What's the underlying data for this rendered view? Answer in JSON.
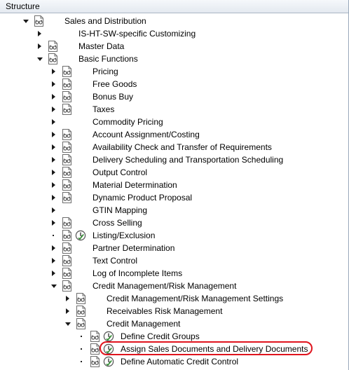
{
  "header": {
    "title": "Structure"
  },
  "tree": [
    {
      "label": "Sales and Distribution",
      "level": 0,
      "node": "down",
      "doc": true,
      "clock": false
    },
    {
      "label": "IS-HT-SW-specific Customizing",
      "level": 1,
      "node": "right",
      "doc": false,
      "clock": false
    },
    {
      "label": "Master Data",
      "level": 1,
      "node": "right",
      "doc": true,
      "clock": false
    },
    {
      "label": "Basic Functions",
      "level": 1,
      "node": "down",
      "doc": true,
      "clock": false
    },
    {
      "label": "Pricing",
      "level": 2,
      "node": "right",
      "doc": true,
      "clock": false
    },
    {
      "label": "Free Goods",
      "level": 2,
      "node": "right",
      "doc": true,
      "clock": false
    },
    {
      "label": "Bonus Buy",
      "level": 2,
      "node": "right",
      "doc": true,
      "clock": false
    },
    {
      "label": "Taxes",
      "level": 2,
      "node": "right",
      "doc": true,
      "clock": false
    },
    {
      "label": "Commodity Pricing",
      "level": 2,
      "node": "right",
      "doc": false,
      "clock": false
    },
    {
      "label": "Account Assignment/Costing",
      "level": 2,
      "node": "right",
      "doc": true,
      "clock": false
    },
    {
      "label": "Availability Check and Transfer of Requirements",
      "level": 2,
      "node": "right",
      "doc": true,
      "clock": false
    },
    {
      "label": "Delivery Scheduling and Transportation Scheduling",
      "level": 2,
      "node": "right",
      "doc": true,
      "clock": false
    },
    {
      "label": "Output Control",
      "level": 2,
      "node": "right",
      "doc": true,
      "clock": false
    },
    {
      "label": "Material Determination",
      "level": 2,
      "node": "right",
      "doc": true,
      "clock": false
    },
    {
      "label": "Dynamic Product Proposal",
      "level": 2,
      "node": "right",
      "doc": true,
      "clock": false
    },
    {
      "label": "GTIN Mapping",
      "level": 2,
      "node": "right",
      "doc": false,
      "clock": false
    },
    {
      "label": "Cross Selling",
      "level": 2,
      "node": "right",
      "doc": true,
      "clock": false
    },
    {
      "label": "Listing/Exclusion",
      "level": 2,
      "node": "dot",
      "doc": true,
      "clock": true
    },
    {
      "label": "Partner Determination",
      "level": 2,
      "node": "right",
      "doc": true,
      "clock": false
    },
    {
      "label": "Text Control",
      "level": 2,
      "node": "right",
      "doc": true,
      "clock": false
    },
    {
      "label": "Log of Incomplete Items",
      "level": 2,
      "node": "right",
      "doc": true,
      "clock": false
    },
    {
      "label": "Credit Management/Risk Management",
      "level": 2,
      "node": "down",
      "doc": true,
      "clock": false
    },
    {
      "label": "Credit Management/Risk Management Settings",
      "level": 3,
      "node": "right",
      "doc": true,
      "clock": false
    },
    {
      "label": "Receivables Risk Management",
      "level": 3,
      "node": "right",
      "doc": true,
      "clock": false
    },
    {
      "label": "Credit Management",
      "level": 3,
      "node": "down",
      "doc": true,
      "clock": false
    },
    {
      "label": "Define Credit Groups",
      "level": 4,
      "node": "dot",
      "doc": true,
      "clock": true
    },
    {
      "label": "Assign Sales Documents and Delivery Documents",
      "level": 4,
      "node": "dot",
      "doc": true,
      "clock": true,
      "highlighted": true
    },
    {
      "label": "Define Automatic Credit Control",
      "level": 4,
      "node": "dot",
      "doc": true,
      "clock": true
    }
  ],
  "colors": {
    "highlight": "#e0141e",
    "header_border": "#aab5c4"
  }
}
